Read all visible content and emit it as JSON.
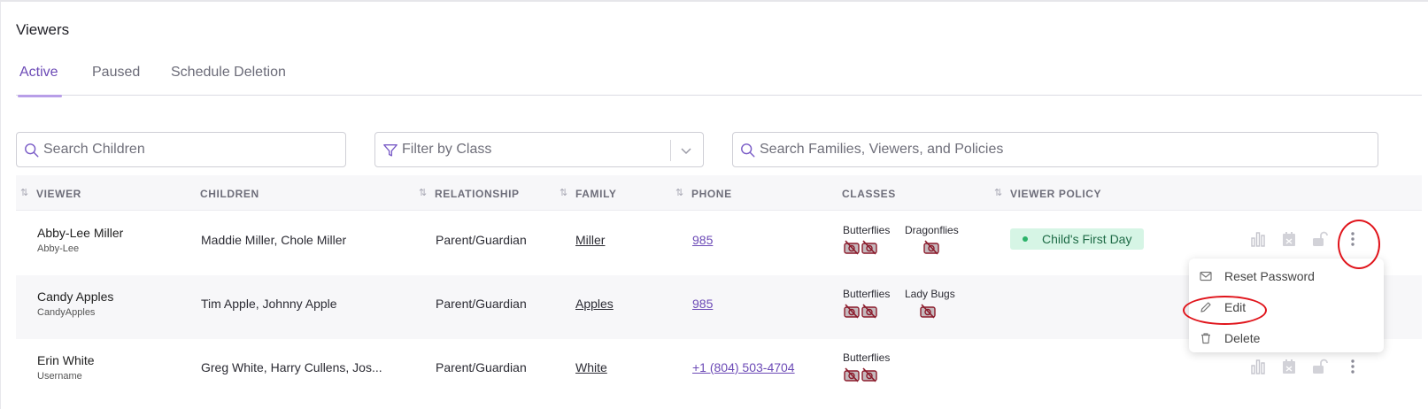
{
  "page": {
    "title": "Viewers"
  },
  "tabs": [
    {
      "label": "Active",
      "active": true
    },
    {
      "label": "Paused",
      "active": false
    },
    {
      "label": "Schedule Deletion",
      "active": false
    }
  ],
  "filters": {
    "search_children_placeholder": "Search Children",
    "filter_class_placeholder": "Filter by Class",
    "search_families_placeholder": "Search Families, Viewers, and Policies"
  },
  "columns": {
    "viewer": "VIEWER",
    "children": "CHILDREN",
    "relationship": "RELATIONSHIP",
    "family": "FAMILY",
    "phone": "PHONE",
    "classes": "CLASSES",
    "viewer_policy": "VIEWER POLICY"
  },
  "rows": [
    {
      "name": "Abby-Lee Miller",
      "username": "Abby-Lee",
      "children": "Maddie Miller, Chole Miller",
      "relationship": "Parent/Guardian",
      "family": "Miller",
      "phone": "985",
      "classes": [
        "Butterflies",
        "Dragonflies"
      ],
      "policy": "Child's First Day"
    },
    {
      "name": "Candy Apples",
      "username": "CandyApples",
      "children": "Tim Apple, Johnny Apple",
      "relationship": "Parent/Guardian",
      "family": "Apples",
      "phone": "985",
      "classes": [
        "Butterflies",
        "Lady Bugs"
      ],
      "policy": ""
    },
    {
      "name": "Erin White",
      "username": "Username",
      "children": "Greg White, Harry Cullens, Jos...",
      "relationship": "Parent/Guardian",
      "family": "White",
      "phone": "+1 (804) 503-4704",
      "classes": [
        "Butterflies"
      ],
      "policy": ""
    }
  ],
  "menu": {
    "reset_password": "Reset Password",
    "edit": "Edit",
    "delete": "Delete"
  },
  "colors": {
    "accent": "#6c4ab6",
    "badge_bg": "#d6f5e5",
    "badge_text": "#1e6b46",
    "annotation": "#e0141b",
    "camera_off": "#8b1a2b"
  },
  "icons": {
    "search": "search-icon",
    "filter": "filter-icon",
    "chevron": "chevron-down-icon",
    "camera_off": "camera-off-icon",
    "stats": "bar-chart-icon",
    "calendar": "calendar-icon",
    "unlock": "unlock-icon",
    "more": "more-vertical-icon",
    "mail": "mail-icon",
    "edit": "pencil-icon",
    "delete": "trash-icon"
  }
}
